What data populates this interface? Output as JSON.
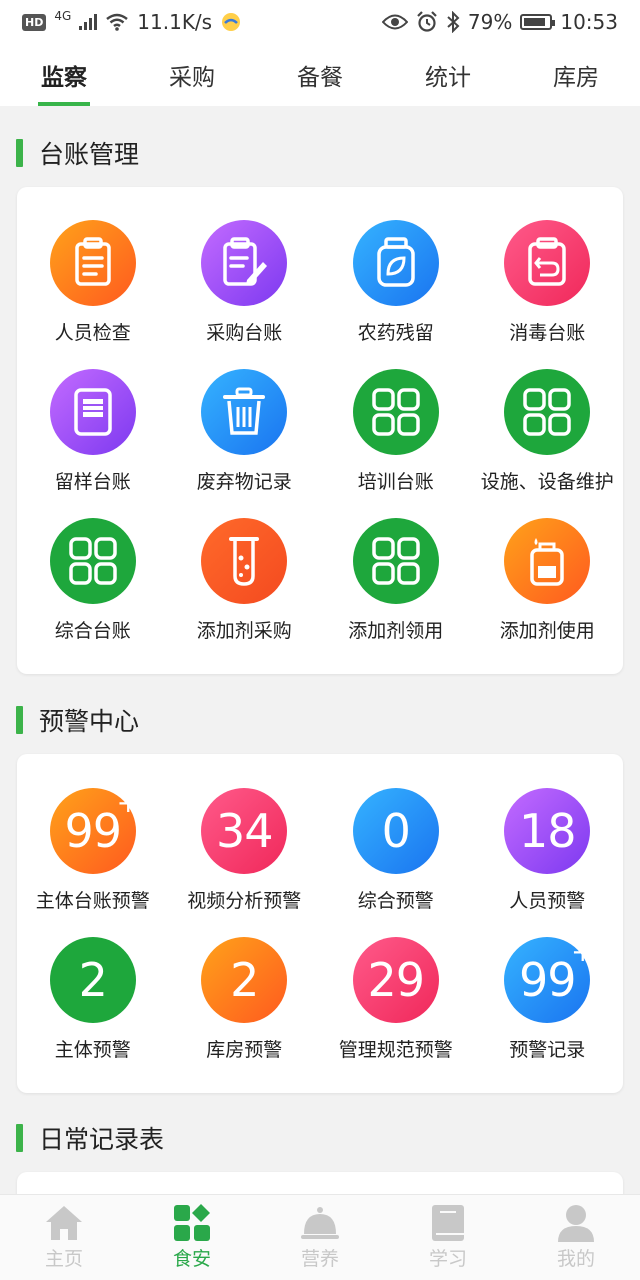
{
  "status_bar": {
    "hd": "HD",
    "network": "4G",
    "speed": "11.1K/s",
    "battery": "79%",
    "time": "10:53"
  },
  "tabs": [
    {
      "label": "监察",
      "active": true
    },
    {
      "label": "采购",
      "active": false
    },
    {
      "label": "备餐",
      "active": false
    },
    {
      "label": "统计",
      "active": false
    },
    {
      "label": "库房",
      "active": false
    }
  ],
  "ledger": {
    "title": "台账管理",
    "items": [
      {
        "label": "人员检查",
        "icon": "clipboard-icon",
        "color": "orange"
      },
      {
        "label": "采购台账",
        "icon": "edit-clipboard-icon",
        "color": "purple"
      },
      {
        "label": "农药残留",
        "icon": "jar-leaf-icon",
        "color": "blue"
      },
      {
        "label": "消毒台账",
        "icon": "return-clipboard-icon",
        "color": "pink"
      },
      {
        "label": "留样台账",
        "icon": "sample-box-icon",
        "color": "purple"
      },
      {
        "label": "废弃物记录",
        "icon": "trash-icon",
        "color": "blue"
      },
      {
        "label": "培训台账",
        "icon": "grid-icon",
        "color": "green"
      },
      {
        "label": "设施、设备维护",
        "icon": "grid-icon",
        "color": "green"
      },
      {
        "label": "综合台账",
        "icon": "grid-icon",
        "color": "green"
      },
      {
        "label": "添加剂采购",
        "icon": "test-tube-icon",
        "color": "redorange"
      },
      {
        "label": "添加剂领用",
        "icon": "grid-icon",
        "color": "green"
      },
      {
        "label": "添加剂使用",
        "icon": "bottle-drop-icon",
        "color": "orange"
      }
    ]
  },
  "warning": {
    "title": "预警中心",
    "items": [
      {
        "label": "主体台账预警",
        "count": "99",
        "plus": "+",
        "color": "orange"
      },
      {
        "label": "视频分析预警",
        "count": "34",
        "plus": "",
        "color": "pink"
      },
      {
        "label": "综合预警",
        "count": "0",
        "plus": "",
        "color": "blue"
      },
      {
        "label": "人员预警",
        "count": "18",
        "plus": "",
        "color": "purple"
      },
      {
        "label": "主体预警",
        "count": "2",
        "plus": "",
        "color": "green"
      },
      {
        "label": "库房预警",
        "count": "2",
        "plus": "",
        "color": "orange"
      },
      {
        "label": "管理规范预警",
        "count": "29",
        "plus": "",
        "color": "pink"
      },
      {
        "label": "预警记录",
        "count": "99",
        "plus": "+",
        "color": "blue"
      }
    ]
  },
  "daily": {
    "title": "日常记录表"
  },
  "bottom_nav": [
    {
      "label": "主页",
      "icon": "home-icon",
      "active": false
    },
    {
      "label": "食安",
      "icon": "food-safety-icon",
      "active": true
    },
    {
      "label": "营养",
      "icon": "dish-cover-icon",
      "active": false
    },
    {
      "label": "学习",
      "icon": "book-icon",
      "active": false
    },
    {
      "label": "我的",
      "icon": "user-icon",
      "active": false
    }
  ],
  "colors": {
    "accent": "#38b54a",
    "nav_active": "#2aa84a",
    "nav_inactive": "#c8c8c8"
  }
}
